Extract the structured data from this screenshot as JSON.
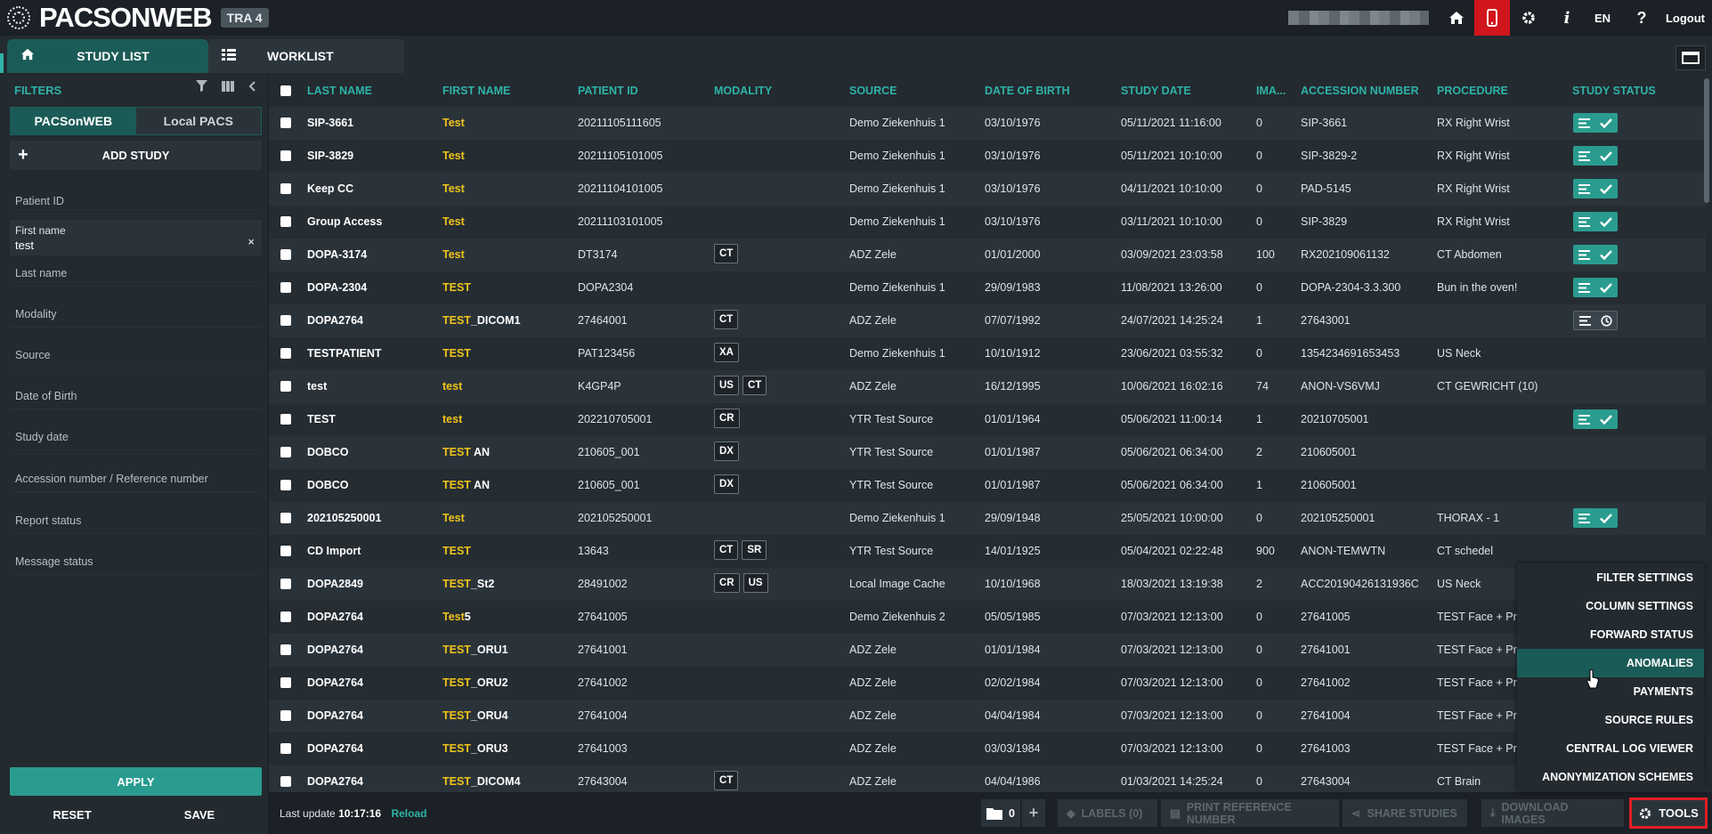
{
  "brand": {
    "logo_text": "PACSONWEB",
    "env_badge": "TRA 4"
  },
  "top_nav": {
    "language": "EN",
    "logout": "Logout"
  },
  "tabs": [
    {
      "label": "STUDY LIST",
      "active": true
    },
    {
      "label": "WORKLIST",
      "active": false
    }
  ],
  "filters": {
    "title": "FILTERS",
    "sources": [
      "PACSonWEB",
      "Local PACS"
    ],
    "add_study": "ADD STUDY",
    "fields": [
      {
        "label": "Patient ID",
        "value": ""
      },
      {
        "label": "First name",
        "value": "test"
      },
      {
        "label": "Last name",
        "value": ""
      },
      {
        "label": "Modality",
        "value": ""
      },
      {
        "label": "Source",
        "value": ""
      },
      {
        "label": "Date of Birth",
        "value": ""
      },
      {
        "label": "Study date",
        "value": ""
      },
      {
        "label": "Accession number / Reference number",
        "value": ""
      },
      {
        "label": "Report status",
        "value": ""
      },
      {
        "label": "Message status",
        "value": ""
      }
    ],
    "apply": "APPLY",
    "reset": "RESET",
    "save": "SAVE"
  },
  "table": {
    "columns": [
      "LAST NAME",
      "FIRST NAME",
      "PATIENT ID",
      "MODALITY",
      "SOURCE",
      "DATE OF BIRTH",
      "STUDY DATE",
      "IMA...",
      "ACCESSION NUMBER",
      "PROCEDURE",
      "STUDY STATUS"
    ],
    "rows": [
      {
        "last": "SIP-3661",
        "first_hl": "Test",
        "first_rest": "",
        "pid": "20211105111605",
        "mod": [],
        "source": "Demo Ziekenhuis 1",
        "dob": "03/10/1976",
        "sdate": "05/11/2021 11:16:00",
        "img": "0",
        "acc": "SIP-3661",
        "proc": "RX Right Wrist",
        "status": "done"
      },
      {
        "last": "SIP-3829",
        "first_hl": "Test",
        "first_rest": "",
        "pid": "20211105101005",
        "mod": [],
        "source": "Demo Ziekenhuis 1",
        "dob": "03/10/1976",
        "sdate": "05/11/2021 10:10:00",
        "img": "0",
        "acc": "SIP-3829-2",
        "proc": "RX Right Wrist",
        "status": "done"
      },
      {
        "last": "Keep CC",
        "first_hl": "Test",
        "first_rest": "",
        "pid": "20211104101005",
        "mod": [],
        "source": "Demo Ziekenhuis 1",
        "dob": "03/10/1976",
        "sdate": "04/11/2021 10:10:00",
        "img": "0",
        "acc": "PAD-5145",
        "proc": "RX Right Wrist",
        "status": "done"
      },
      {
        "last": "Group Access",
        "first_hl": "Test",
        "first_rest": "",
        "pid": "20211103101005",
        "mod": [],
        "source": "Demo Ziekenhuis 1",
        "dob": "03/10/1976",
        "sdate": "03/11/2021 10:10:00",
        "img": "0",
        "acc": "SIP-3829",
        "proc": "RX Right Wrist",
        "status": "done"
      },
      {
        "last": "DOPA-3174",
        "first_hl": "Test",
        "first_rest": "",
        "pid": "DT3174",
        "mod": [
          "CT"
        ],
        "source": "ADZ Zele",
        "dob": "01/01/2000",
        "sdate": "03/09/2021 23:03:58",
        "img": "100",
        "acc": "RX202109061132",
        "proc": "CT Abdomen",
        "status": "done"
      },
      {
        "last": "DOPA-2304",
        "first_hl": "TEST",
        "first_rest": "",
        "pid": "DOPA2304",
        "mod": [],
        "source": "Demo Ziekenhuis 1",
        "dob": "29/09/1983",
        "sdate": "11/08/2021 13:26:00",
        "img": "0",
        "acc": "DOPA-2304-3.3.300",
        "proc": "Bun in the oven!",
        "status": "done"
      },
      {
        "last": "DOPA2764",
        "first_hl": "TEST",
        "first_rest": "_DICOM1",
        "pid": "27464001",
        "mod": [
          "CT"
        ],
        "source": "ADZ Zele",
        "dob": "07/07/1992",
        "sdate": "24/07/2021 14:25:24",
        "img": "1",
        "acc": "27643001",
        "proc": "",
        "status": "pending"
      },
      {
        "last": "TESTPATIENT",
        "first_hl": "TEST",
        "first_rest": "",
        "pid": "PAT123456",
        "mod": [
          "XA"
        ],
        "source": "Demo Ziekenhuis 1",
        "dob": "10/10/1912",
        "sdate": "23/06/2021 03:55:32",
        "img": "0",
        "acc": "1354234691653453",
        "proc": "US Neck",
        "status": ""
      },
      {
        "last": "test",
        "first_hl": "test",
        "first_rest": "",
        "pid": "K4GP4P",
        "mod": [
          "US",
          "CT"
        ],
        "source": "ADZ Zele",
        "dob": "16/12/1995",
        "sdate": "10/06/2021 16:02:16",
        "img": "74",
        "acc": "ANON-VS6VMJ",
        "proc": "CT GEWRICHT (10)",
        "status": ""
      },
      {
        "last": "TEST",
        "first_hl": "test",
        "first_rest": "",
        "pid": "202210705001",
        "mod": [
          "CR"
        ],
        "source": "YTR Test Source",
        "dob": "01/01/1964",
        "sdate": "05/06/2021 11:00:14",
        "img": "1",
        "acc": "20210705001",
        "proc": "",
        "status": "done"
      },
      {
        "last": "DOBCO",
        "first_hl": "TEST",
        "first_rest": " AN",
        "pid": "210605_001",
        "mod": [
          "DX"
        ],
        "source": "YTR Test Source",
        "dob": "01/01/1987",
        "sdate": "05/06/2021 06:34:00",
        "img": "2",
        "acc": "210605001",
        "proc": "",
        "status": ""
      },
      {
        "last": "DOBCO",
        "first_hl": "TEST",
        "first_rest": " AN",
        "pid": "210605_001",
        "mod": [
          "DX"
        ],
        "source": "YTR Test Source",
        "dob": "01/01/1987",
        "sdate": "05/06/2021 06:34:00",
        "img": "1",
        "acc": "210605001",
        "proc": "",
        "status": ""
      },
      {
        "last": "202105250001",
        "first_hl": "Test",
        "first_rest": "",
        "pid": "202105250001",
        "mod": [],
        "source": "Demo Ziekenhuis 1",
        "dob": "29/09/1948",
        "sdate": "25/05/2021 10:00:00",
        "img": "0",
        "acc": "202105250001",
        "proc": "THORAX - 1",
        "status": "done"
      },
      {
        "last": "CD Import",
        "first_hl": "TEST",
        "first_rest": "",
        "pid": "13643",
        "mod": [
          "CT",
          "SR"
        ],
        "source": "YTR Test Source",
        "dob": "14/01/1925",
        "sdate": "05/04/2021 02:22:48",
        "img": "900",
        "acc": "ANON-TEMWTN",
        "proc": "CT schedel",
        "status": ""
      },
      {
        "last": "DOPA2849",
        "first_hl": "TEST",
        "first_rest": "_St2",
        "pid": "28491002",
        "mod": [
          "CR",
          "US"
        ],
        "source": "Local Image Cache",
        "dob": "10/10/1968",
        "sdate": "18/03/2021 13:19:38",
        "img": "2",
        "acc": "ACC20190426131936C",
        "proc": "US Neck",
        "status": ""
      },
      {
        "last": "DOPA2764",
        "first_hl": "Test",
        "first_rest": "5",
        "pid": "27641005",
        "mod": [],
        "source": "Demo Ziekenhuis 2",
        "dob": "05/05/1985",
        "sdate": "07/03/2021 12:13:00",
        "img": "0",
        "acc": "27641005",
        "proc": "TEST Face + Pro",
        "status": ""
      },
      {
        "last": "DOPA2764",
        "first_hl": "TEST",
        "first_rest": "_ORU1",
        "pid": "27641001",
        "mod": [],
        "source": "ADZ Zele",
        "dob": "01/01/1984",
        "sdate": "07/03/2021 12:13:00",
        "img": "0",
        "acc": "27641001",
        "proc": "TEST Face + Pro",
        "status": ""
      },
      {
        "last": "DOPA2764",
        "first_hl": "TEST",
        "first_rest": "_ORU2",
        "pid": "27641002",
        "mod": [],
        "source": "ADZ Zele",
        "dob": "02/02/1984",
        "sdate": "07/03/2021 12:13:00",
        "img": "0",
        "acc": "27641002",
        "proc": "TEST Face + Pro",
        "status": ""
      },
      {
        "last": "DOPA2764",
        "first_hl": "TEST",
        "first_rest": "_ORU4",
        "pid": "27641004",
        "mod": [],
        "source": "ADZ Zele",
        "dob": "04/04/1984",
        "sdate": "07/03/2021 12:13:00",
        "img": "0",
        "acc": "27641004",
        "proc": "TEST Face + Pro",
        "status": ""
      },
      {
        "last": "DOPA2764",
        "first_hl": "TEST",
        "first_rest": "_ORU3",
        "pid": "27641003",
        "mod": [],
        "source": "ADZ Zele",
        "dob": "03/03/1984",
        "sdate": "07/03/2021 12:13:00",
        "img": "0",
        "acc": "27641003",
        "proc": "TEST Face + Pro",
        "status": ""
      },
      {
        "last": "DOPA2764",
        "first_hl": "TEST",
        "first_rest": "_DICOM4",
        "pid": "27643004",
        "mod": [
          "CT"
        ],
        "source": "ADZ Zele",
        "dob": "04/04/1986",
        "sdate": "01/03/2021 14:25:24",
        "img": "0",
        "acc": "27643004",
        "proc": "CT Brain",
        "status": ""
      }
    ]
  },
  "bottom": {
    "last_update_label": "Last update",
    "last_update_time": "10:17:16",
    "reload": "Reload",
    "folder_count": "0",
    "labels": "LABELS (0)",
    "print_ref": "PRINT REFERENCE NUMBER",
    "share": "SHARE STUDIES",
    "download": "DOWNLOAD IMAGES",
    "tools": "TOOLS"
  },
  "tools_menu": {
    "items": [
      "FILTER SETTINGS",
      "COLUMN SETTINGS",
      "FORWARD STATUS",
      "ANOMALIES",
      "PAYMENTS",
      "SOURCE RULES",
      "CENTRAL LOG VIEWER",
      "ANONYMIZATION SCHEMES"
    ],
    "selected": "ANOMALIES"
  },
  "colors": {
    "accent": "#2eb3a7",
    "active_tab": "#1b5b57",
    "highlight": "#f0c419",
    "alert": "#d0161c"
  }
}
